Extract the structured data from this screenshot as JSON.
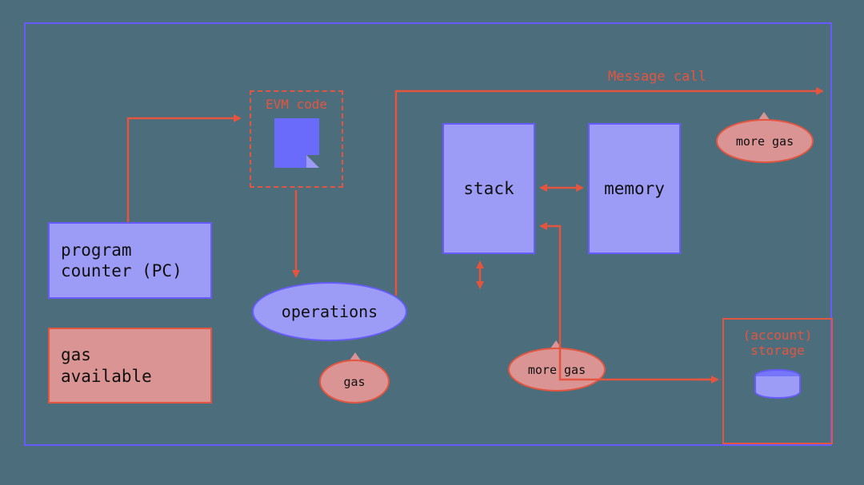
{
  "diagram": {
    "program_counter": "program\ncounter (PC)",
    "gas_available": "gas\navailable",
    "evm_code": "EVM code",
    "operations": "operations",
    "stack": "stack",
    "memory": "memory",
    "message_call": "Message call",
    "gas_bubble": "gas",
    "more_gas_1": "more gas",
    "more_gas_2": "more gas",
    "account": "(account)",
    "storage": "storage"
  },
  "colors": {
    "bg": "#4C6D7C",
    "purple_fill": "#9C9CF7",
    "purple_stroke": "#675BFF",
    "red_fill": "#DB9494",
    "orange": "#E4553F"
  }
}
